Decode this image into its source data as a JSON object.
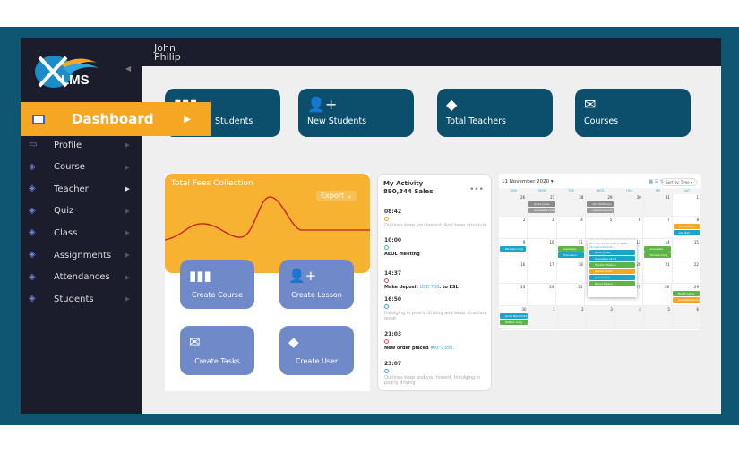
{
  "header": {
    "user_name_line1": "John",
    "user_name_line2": "Philip"
  },
  "logo": {
    "text": "LMS",
    "subtitle": "Learning Management System"
  },
  "sidebar": {
    "active": "Dashboard",
    "items": [
      {
        "label": "Profile",
        "icon": "panel-icon"
      },
      {
        "label": "Course",
        "icon": "diamond-icon"
      },
      {
        "label": "Teacher",
        "icon": "diamond-icon"
      },
      {
        "label": "Quiz",
        "icon": "diamond-icon"
      },
      {
        "label": "Class",
        "icon": "diamond-icon"
      },
      {
        "label": "Assignments",
        "icon": "diamond-icon"
      },
      {
        "label": "Attendances",
        "icon": "diamond-icon"
      },
      {
        "label": "Students",
        "icon": "diamond-icon"
      }
    ]
  },
  "cards": [
    {
      "label": "Students",
      "icon": "bar-chart-icon"
    },
    {
      "label": "New Students",
      "icon": "add-user-icon"
    },
    {
      "label": "Total Teachers",
      "icon": "layers-icon"
    },
    {
      "label": "Courses",
      "icon": "folder-icon"
    }
  ],
  "fees": {
    "title": "Total Fees Collection",
    "export": "Export"
  },
  "actions": [
    {
      "label": "Create Course",
      "icon": "bar-chart-icon"
    },
    {
      "label": "Create Lesson",
      "icon": "add-user-icon"
    },
    {
      "label": "Create Tasks",
      "icon": "folder-icon"
    },
    {
      "label": "Create User",
      "icon": "layers-icon"
    }
  ],
  "activity": {
    "title": "My Activity",
    "subtitle": "890,344 Sales",
    "events": [
      {
        "time": "08:42",
        "color": "#f5a623",
        "parts": [
          {
            "t": "Outlines keep you honest. And keep structure",
            "k": "gray"
          }
        ]
      },
      {
        "time": "10:00",
        "color": "#4db6ac",
        "parts": [
          {
            "t": "AEOL meeting",
            "k": "blk"
          }
        ]
      },
      {
        "time": "14:37",
        "color": "#e84a5f",
        "parts": [
          {
            "t": "Make deposit ",
            "k": "blk"
          },
          {
            "t": "USD 700",
            "k": "lnk"
          },
          {
            "t": ". to ESL",
            "k": "blk"
          }
        ]
      },
      {
        "time": "16:50",
        "color": "#2fa6e0",
        "parts": [
          {
            "t": "Indulging in poorly driving and keep structure great",
            "k": "gray"
          }
        ]
      },
      {
        "time": "21:03",
        "color": "#e84a5f",
        "parts": [
          {
            "t": "New order placed ",
            "k": "blk"
          },
          {
            "t": "#XF-2356.",
            "k": "lnk"
          }
        ]
      },
      {
        "time": "23:07",
        "color": "#2fa6e0",
        "parts": [
          {
            "t": "Outlines keep and you honest. Indulging in poorly driving",
            "k": "gray"
          }
        ]
      }
    ]
  },
  "calendar": {
    "title": "11 November 2020 ▾",
    "sort": "Sort by: Time ▾",
    "days": [
      "SUN",
      "MON",
      "TUE",
      "WED",
      "THU",
      "FRI",
      "SAT"
    ],
    "weeks": [
      [
        {
          "n": "26",
          "o": true
        },
        {
          "n": "27",
          "o": true,
          "ev": [
            [
              "Jacob Jones",
              "#8a8a8a"
            ],
            [
              "Annabelle Linda",
              "#9a9a9a"
            ]
          ]
        },
        {
          "n": "28",
          "o": true
        },
        {
          "n": "29",
          "o": true,
          "ev": [
            [
              "Ann Wilkinson",
              "#8a8a8a"
            ],
            [
              "Lawrence Long",
              "#9a9a9a"
            ]
          ]
        },
        {
          "n": "30",
          "o": true
        },
        {
          "n": "31",
          "o": true
        },
        {
          "n": "1"
        }
      ],
      [
        {
          "n": "2"
        },
        {
          "n": "3"
        },
        {
          "n": "4"
        },
        {
          "n": "5"
        },
        {
          "n": "6"
        },
        {
          "n": "7"
        },
        {
          "n": "8",
          "ev": [
            [
              "Kris Madison",
              "#f5a623"
            ],
            [
              "Alia Bell",
              "#1aa6c9"
            ]
          ]
        }
      ],
      [
        {
          "n": "9",
          "ev": [
            [
              "Michael Long",
              "#1aa6c9"
            ]
          ]
        },
        {
          "n": "10"
        },
        {
          "n": "11",
          "ev": [
            [
              "Anastasia",
              "#5cb546"
            ],
            [
              "Francesca",
              "#1aa6c9"
            ]
          ]
        },
        {
          "n": "12"
        },
        {
          "n": "13"
        },
        {
          "n": "14",
          "ev": [
            [
              "Anastasia",
              "#5cb546"
            ],
            [
              "Michael Long",
              "#5cb546"
            ]
          ]
        },
        {
          "n": "15"
        }
      ],
      [
        {
          "n": "16"
        },
        {
          "n": "17"
        },
        {
          "n": "18"
        },
        {
          "n": "19"
        },
        {
          "n": "20"
        },
        {
          "n": "21"
        },
        {
          "n": "22"
        }
      ],
      [
        {
          "n": "23"
        },
        {
          "n": "24"
        },
        {
          "n": "25"
        },
        {
          "n": "26"
        },
        {
          "n": "27"
        },
        {
          "n": "28"
        },
        {
          "n": "29",
          "ev": [
            [
              "Heath Linda",
              "#5cb546"
            ],
            [
              "Annabelle Linda",
              "#f5a623"
            ]
          ]
        }
      ],
      [
        {
          "n": "30",
          "ev": [
            [
              "Jacob Beaumont",
              "#1aa6c9"
            ],
            [
              "William Long",
              "#5cb546"
            ]
          ]
        },
        {
          "n": "1",
          "o": true
        },
        {
          "n": "2",
          "o": true
        },
        {
          "n": "3",
          "o": true
        },
        {
          "n": "4",
          "o": true
        },
        {
          "n": "5",
          "o": true
        },
        {
          "n": "6",
          "o": true
        }
      ]
    ],
    "popup": {
      "title": "Tuesday 11 November 2020",
      "count": "16 Appointments",
      "items": [
        [
          "Jacob Jones",
          "#1aa6c9"
        ],
        [
          "Annabelle Linda",
          "#1aa6c9"
        ],
        [
          "Franklin Helsius",
          "#5cb546"
        ],
        [
          "Jessica Linda",
          "#f5a623"
        ],
        [
          "Jeremy Lee",
          "#1aa6c9"
        ],
        [
          "David Gibson",
          "#5cb546"
        ]
      ]
    }
  }
}
